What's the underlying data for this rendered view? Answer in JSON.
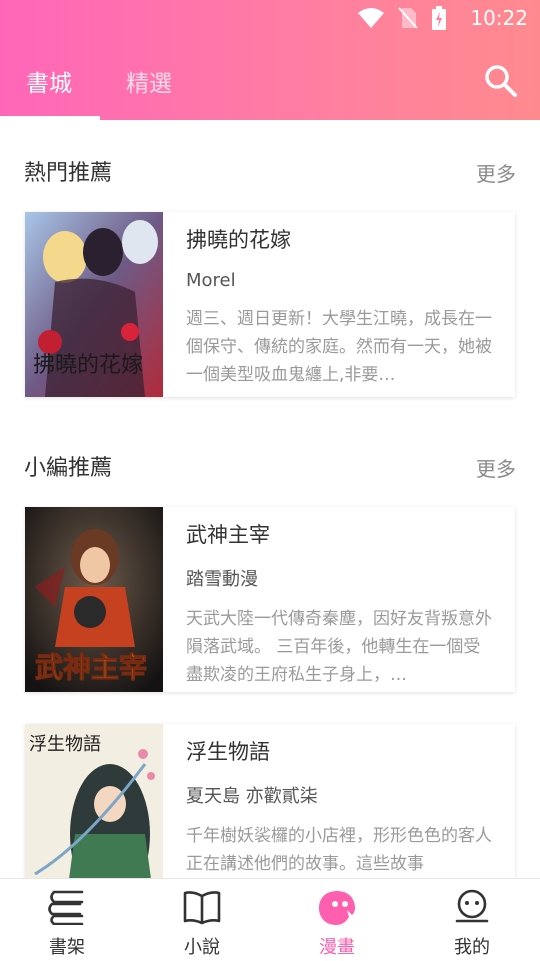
{
  "status_bar": {
    "time": "10:22"
  },
  "tabs": [
    {
      "label": "書城"
    },
    {
      "label": "精選"
    }
  ],
  "sections": [
    {
      "title": "熱門推薦",
      "more": "更多"
    },
    {
      "title": "小編推薦",
      "more": "更多"
    }
  ],
  "books": [
    {
      "title": "拂曉的花嫁",
      "author": "Morel",
      "description": "週三、週日更新！大學生江曉，成長在一個保守、傳統的家庭。然而有一天，她被一個美型吸血鬼纏上,非要…",
      "cover_text": "拂曉的花嫁"
    },
    {
      "title": "武神主宰",
      "author": "踏雪動漫",
      "description": "天武大陸一代傳奇秦塵，因好友背叛意外隕落武域。 三百年後，他轉生在一個受盡欺凌的王府私生子身上，…",
      "cover_text": "武神主宰"
    },
    {
      "title": "浮生物語",
      "author": "夏天島 亦歡貳柒",
      "description": "千年樹妖裟欏的小店裡，形形色色的客人正在講述他們的故事。這些故事",
      "cover_text": "浮生物語"
    }
  ],
  "bottom_nav": [
    {
      "label": "書架",
      "icon": "bookshelf-icon"
    },
    {
      "label": "小說",
      "icon": "book-icon"
    },
    {
      "label": "漫畫",
      "icon": "comic-icon",
      "active": true
    },
    {
      "label": "我的",
      "icon": "profile-icon"
    }
  ],
  "colors": {
    "accent": "#ff5fae",
    "header_start": "#ff66b8",
    "header_end": "#ff8a8e"
  }
}
